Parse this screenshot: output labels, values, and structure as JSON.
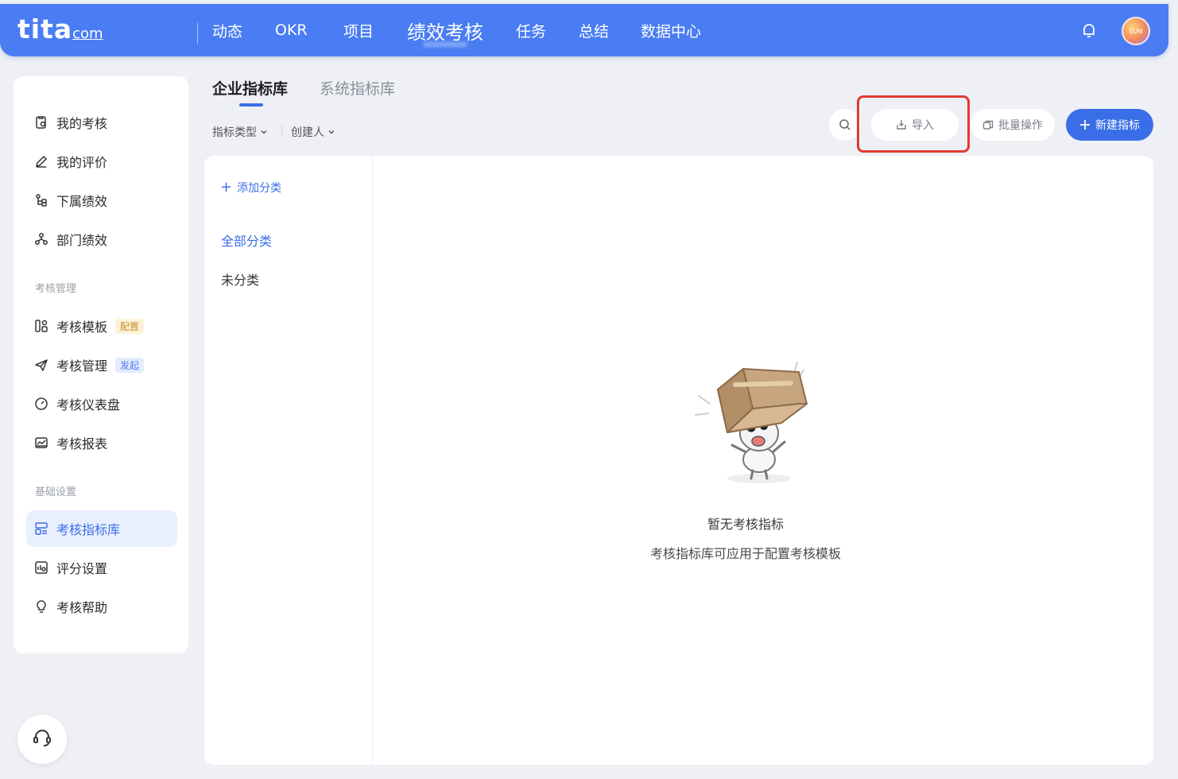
{
  "app": {
    "logo": "tita",
    "logo_suffix": "com",
    "avatar_text": "SUN"
  },
  "nav": {
    "items": [
      {
        "label": "动态"
      },
      {
        "label": "OKR"
      },
      {
        "label": "项目"
      },
      {
        "label": "绩效考核",
        "active": true
      },
      {
        "label": "任务"
      },
      {
        "label": "总结"
      },
      {
        "label": "数据中心"
      }
    ]
  },
  "sidebar": {
    "items": [
      {
        "label": "我的考核",
        "icon": "my-review-icon"
      },
      {
        "label": "我的评价",
        "icon": "edit-icon"
      },
      {
        "label": "下属绩效",
        "icon": "subordinate-icon"
      },
      {
        "label": "部门绩效",
        "icon": "department-icon"
      }
    ],
    "group_manage": "考核管理",
    "manage_items": [
      {
        "label": "考核模板",
        "icon": "template-icon",
        "tag": "配置"
      },
      {
        "label": "考核管理",
        "icon": "send-icon",
        "tag": "发起"
      },
      {
        "label": "考核仪表盘",
        "icon": "dashboard-icon"
      },
      {
        "label": "考核报表",
        "icon": "report-icon"
      }
    ],
    "group_basic": "基础设置",
    "basic_items": [
      {
        "label": "考核指标库",
        "icon": "indicator-library-icon",
        "active": true
      },
      {
        "label": "评分设置",
        "icon": "score-settings-icon"
      },
      {
        "label": "考核帮助",
        "icon": "lightbulb-icon"
      }
    ]
  },
  "tabs": {
    "enterprise": "企业指标库",
    "system": "系统指标库"
  },
  "filters": {
    "type": "指标类型",
    "creator": "创建人"
  },
  "toolbar": {
    "import": "导入",
    "batch": "批量操作",
    "new": "新建指标"
  },
  "categories": {
    "add": "添加分类",
    "all": "全部分类",
    "uncategorized": "未分类"
  },
  "empty": {
    "title": "暂无考核指标",
    "desc": "考核指标库可应用于配置考核模板"
  },
  "colors": {
    "primary": "#3a6ee8",
    "topbar": "#4a7df3",
    "highlight": "#e33b2e"
  }
}
